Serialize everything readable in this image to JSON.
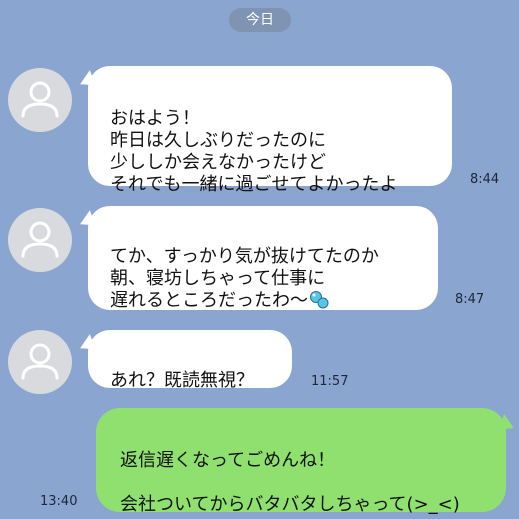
{
  "date_label": "今日",
  "messages": [
    {
      "side": "in",
      "text": "おはよう！\n昨日は久しぶりだったのに\n少ししか会えなかったけど\nそれでも一緒に過ごせてよかったよ",
      "time": "8:44"
    },
    {
      "side": "in",
      "text": "てか、すっかり気が抜けてたのか\n朝、寝坊しちゃって仕事に\n遅れるところだったわ〜",
      "time": "8:47",
      "trailing_icon": "blue-droplets-emoji-icon"
    },
    {
      "side": "in",
      "text": "あれ？既読無視？",
      "time": "11:57"
    },
    {
      "side": "out",
      "text": "返信遅くなってごめんね！\n\n会社ついてからバタバタしちゃって(>_<)",
      "time": "13:40"
    }
  ],
  "colors": {
    "background": "#8aa5cf",
    "incoming_bubble": "#ffffff",
    "outgoing_bubble": "#90e070",
    "avatar": "#d9dadd"
  }
}
